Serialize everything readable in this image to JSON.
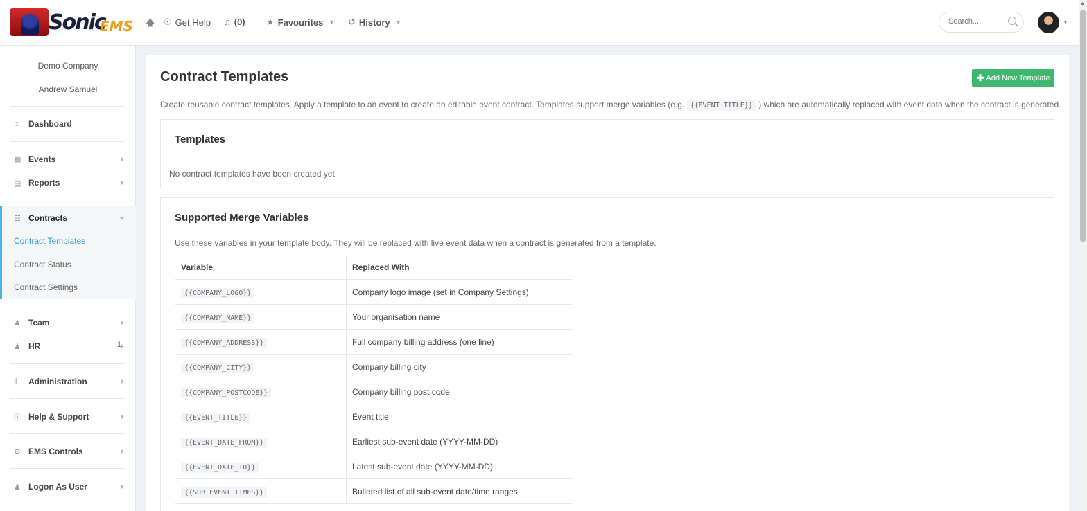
{
  "brand": {
    "name": "Sonic",
    "suffix": "EMS"
  },
  "topnav": {
    "get_help": "Get Help",
    "notifications": "(0)",
    "favourites": "Favourites",
    "history": "History",
    "search_placeholder": "Search..."
  },
  "sidebar": {
    "company": "Demo Company",
    "user": "Andrew Samuel",
    "items": {
      "dashboard": "Dashboard",
      "events": "Events",
      "reports": "Reports",
      "contracts": "Contracts",
      "team": "Team",
      "hr": "HR",
      "hr_badge": "1",
      "administration": "Administration",
      "help": "Help & Support",
      "ems_controls": "EMS Controls",
      "logon_as_user": "Logon As User"
    },
    "contracts_sub": {
      "templates": "Contract Templates",
      "status": "Contract Status",
      "settings": "Contract Settings"
    }
  },
  "main": {
    "title": "Contract Templates",
    "add_button": "Add New Template",
    "description_pre": "Create reusable contract templates. Apply a template to an event to create an editable event contract. Templates support merge variables (e.g.",
    "description_code": "{{EVENT_TITLE}}",
    "description_post": ") which are automatically replaced with event data when the contract is generated.",
    "templates_panel": {
      "title": "Templates",
      "empty": "No contract templates have been created yet."
    },
    "merge_panel": {
      "title": "Supported Merge Variables",
      "description": "Use these variables in your template body. They will be replaced with live event data when a contract is generated from a template.",
      "col_variable": "Variable",
      "col_replaced": "Replaced With",
      "rows": [
        {
          "var": "{{COMPANY_LOGO}}",
          "desc": "Company logo image (set in Company Settings)"
        },
        {
          "var": "{{COMPANY_NAME}}",
          "desc": "Your organisation name"
        },
        {
          "var": "{{COMPANY_ADDRESS}}",
          "desc": "Full company billing address (one line)"
        },
        {
          "var": "{{COMPANY_CITY}}",
          "desc": "Company billing city"
        },
        {
          "var": "{{COMPANY_POSTCODE}}",
          "desc": "Company billing post code"
        },
        {
          "var": "{{EVENT_TITLE}}",
          "desc": "Event title"
        },
        {
          "var": "{{EVENT_DATE_FROM}}",
          "desc": "Earliest sub-event date (YYYY-MM-DD)"
        },
        {
          "var": "{{EVENT_DATE_TO}}",
          "desc": "Latest sub-event date (YYYY-MM-DD)"
        },
        {
          "var": "{{SUB_EVENT_TIMES}}",
          "desc": "Bulleted list of all sub-event date/time ranges"
        }
      ]
    }
  }
}
